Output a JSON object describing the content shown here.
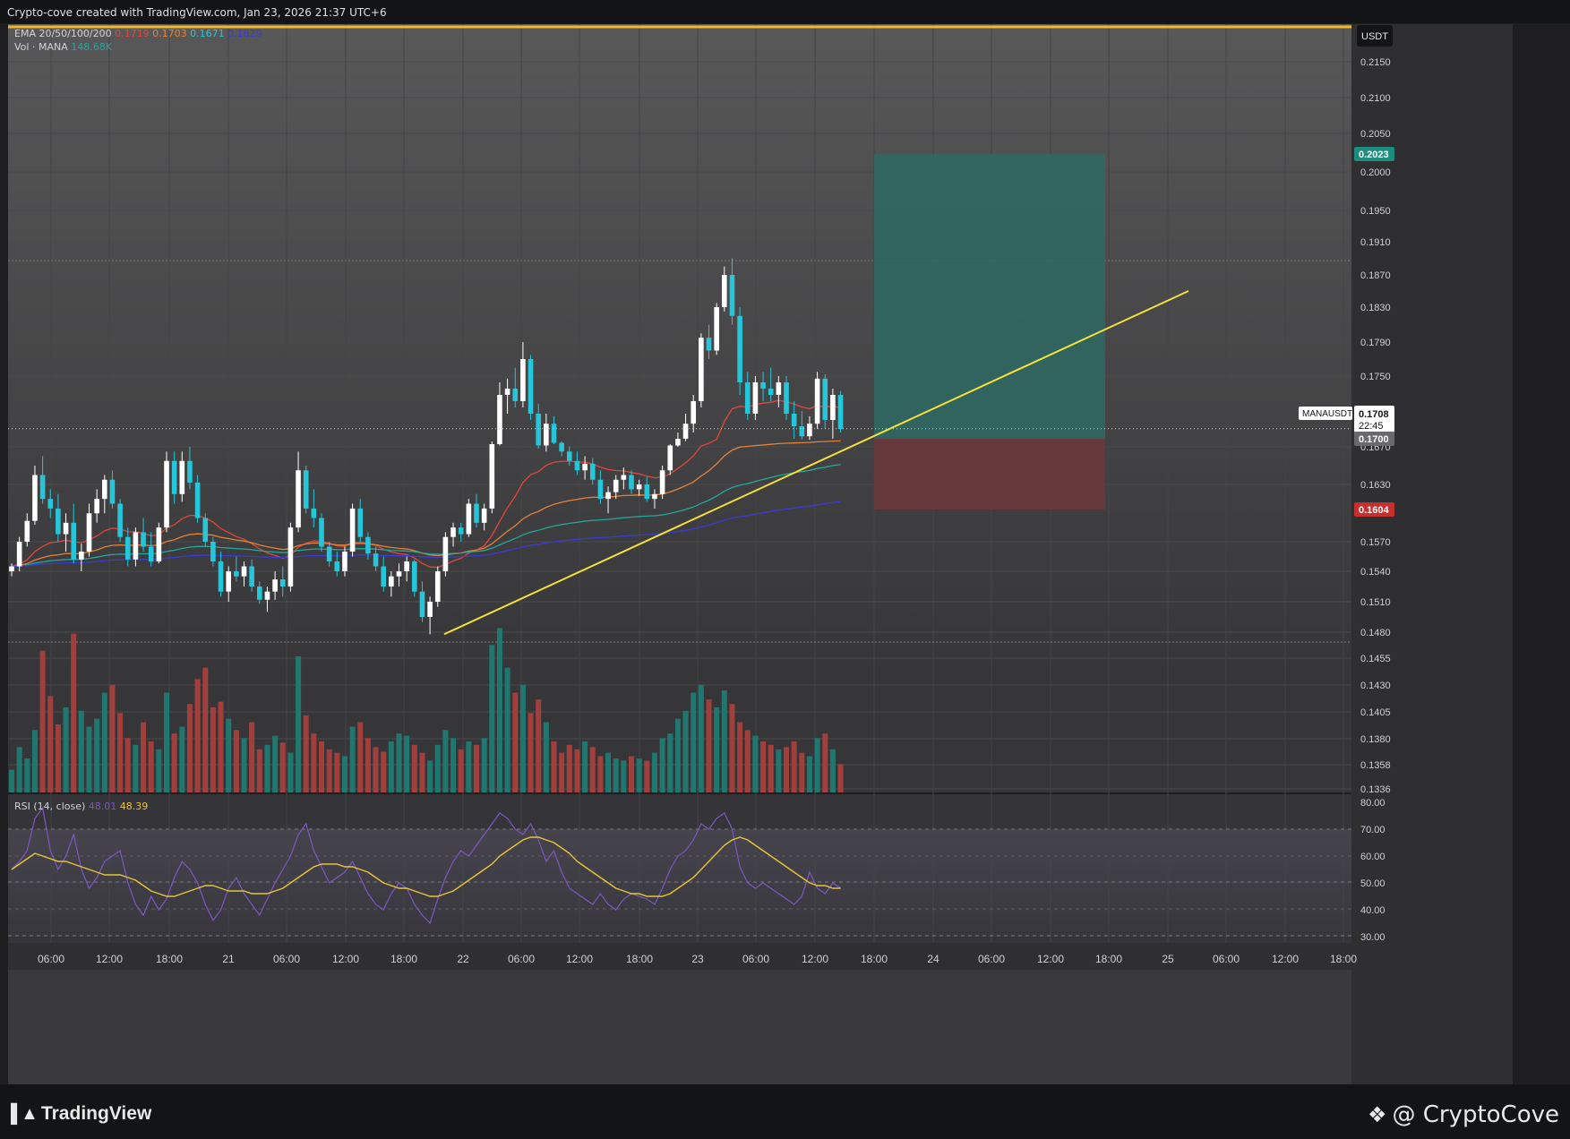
{
  "header": {
    "attribution": "Crypto-cove created with TradingView.com, Jan 23, 2026 21:37 UTC+6"
  },
  "legend": {
    "ema_label": "EMA 20/50/100/200",
    "ema_values": [
      "0.1719",
      "0.1703",
      "0.1671",
      "0.1629"
    ],
    "vol_label": "Vol · MANA",
    "vol_value": "148.68K",
    "rsi_label": "RSI (14, close)",
    "rsi_value": "48.01",
    "rsi_ma_value": "48.39"
  },
  "price_axis": {
    "currency": "USDT",
    "ticks": [
      "0.2150",
      "0.2100",
      "0.2050",
      "0.2000",
      "0.1950",
      "0.1910",
      "0.1870",
      "0.1830",
      "0.1790",
      "0.1750",
      "0.1670",
      "0.1630",
      "0.1570",
      "0.1540",
      "0.1510",
      "0.1480",
      "0.1455",
      "0.1430",
      "0.1405",
      "0.1380",
      "0.1358",
      "0.1336"
    ],
    "rsi_ticks": [
      "80.00",
      "70.00",
      "60.00",
      "50.00",
      "40.00",
      "30.00"
    ],
    "target_label": "0.2023",
    "current_symbol": "MANAUSDT",
    "current_price": "0.1708",
    "countdown": "22:45",
    "entry_label": "0.1700",
    "stop_label": "0.1604"
  },
  "time_axis": {
    "ticks": [
      "06:00",
      "12:00",
      "18:00",
      "21",
      "06:00",
      "12:00",
      "18:00",
      "22",
      "06:00",
      "12:00",
      "18:00",
      "23",
      "06:00",
      "12:00",
      "18:00",
      "24",
      "06:00",
      "12:00",
      "18:00",
      "25",
      "06:00",
      "12:00",
      "18:00"
    ]
  },
  "footer": {
    "tv_brand": "TradingView",
    "cc_brand": "@ CryptoCove"
  },
  "colors": {
    "up": "#26a69a",
    "down": "#ef5350",
    "trendline": "#f5e13a",
    "ema20": "#e0463b",
    "ema50": "#e3823b",
    "ema100": "#26a69a",
    "ema200": "#3b3bd6",
    "target_zone": "#2e6a63",
    "stop_zone": "#6a3a3c",
    "rsi": "#7e57c2",
    "rsi_ma": "#e8c53a"
  },
  "chart_data": {
    "type": "candlestick",
    "symbol": "MANAUSDT",
    "ylim": [
      0.1336,
      0.218
    ],
    "x_range": [
      "Jan 20 02:00",
      "Jan 25 22:00"
    ],
    "trendline": {
      "from": [
        "Jan 21 20:00",
        0.1478
      ],
      "to": [
        "Jan 24 22:00",
        0.185
      ]
    },
    "position": {
      "entry": 0.17,
      "target": 0.2023,
      "stop": 0.1604,
      "last": 0.1708
    },
    "candles": [
      [
        0.154,
        0.1548,
        0.1535,
        0.1545
      ],
      [
        0.1545,
        0.1575,
        0.154,
        0.157
      ],
      [
        0.157,
        0.16,
        0.1565,
        0.1592
      ],
      [
        0.1592,
        0.165,
        0.1588,
        0.164
      ],
      [
        0.164,
        0.166,
        0.161,
        0.1615
      ],
      [
        0.1615,
        0.1625,
        0.1595,
        0.1605
      ],
      [
        0.1605,
        0.162,
        0.157,
        0.1578
      ],
      [
        0.1578,
        0.16,
        0.156,
        0.159
      ],
      [
        0.159,
        0.161,
        0.1548,
        0.1552
      ],
      [
        0.1552,
        0.1568,
        0.154,
        0.156
      ],
      [
        0.156,
        0.161,
        0.1555,
        0.16
      ],
      [
        0.16,
        0.1625,
        0.159,
        0.1615
      ],
      [
        0.1615,
        0.164,
        0.16,
        0.1635
      ],
      [
        0.1635,
        0.1645,
        0.1605,
        0.161
      ],
      [
        0.161,
        0.1615,
        0.157,
        0.1575
      ],
      [
        0.1575,
        0.1585,
        0.1545,
        0.1552
      ],
      [
        0.1552,
        0.1585,
        0.1545,
        0.158
      ],
      [
        0.158,
        0.1595,
        0.156,
        0.1565
      ],
      [
        0.1565,
        0.158,
        0.1545,
        0.155
      ],
      [
        0.155,
        0.159,
        0.1548,
        0.1585
      ],
      [
        0.1585,
        0.1665,
        0.158,
        0.1655
      ],
      [
        0.1655,
        0.1665,
        0.161,
        0.162
      ],
      [
        0.162,
        0.1665,
        0.1612,
        0.1655
      ],
      [
        0.1655,
        0.167,
        0.1625,
        0.1632
      ],
      [
        0.1632,
        0.164,
        0.159,
        0.1595
      ],
      [
        0.1595,
        0.16,
        0.1565,
        0.157
      ],
      [
        0.157,
        0.1575,
        0.1545,
        0.155
      ],
      [
        0.155,
        0.156,
        0.1515,
        0.152
      ],
      [
        0.152,
        0.1545,
        0.151,
        0.154
      ],
      [
        0.154,
        0.1555,
        0.153,
        0.1535
      ],
      [
        0.1535,
        0.155,
        0.1525,
        0.1545
      ],
      [
        0.1545,
        0.1552,
        0.152,
        0.1525
      ],
      [
        0.1525,
        0.153,
        0.1508,
        0.1512
      ],
      [
        0.1512,
        0.1525,
        0.15,
        0.152
      ],
      [
        0.152,
        0.154,
        0.1512,
        0.1532
      ],
      [
        0.1532,
        0.1545,
        0.1515,
        0.1525
      ],
      [
        0.1525,
        0.159,
        0.152,
        0.1585
      ],
      [
        0.1585,
        0.1665,
        0.158,
        0.1645
      ],
      [
        0.1645,
        0.165,
        0.16,
        0.1605
      ],
      [
        0.1605,
        0.1625,
        0.1585,
        0.1595
      ],
      [
        0.1595,
        0.16,
        0.156,
        0.1565
      ],
      [
        0.1565,
        0.157,
        0.1545,
        0.155
      ],
      [
        0.155,
        0.156,
        0.1535,
        0.154
      ],
      [
        0.154,
        0.1565,
        0.1535,
        0.156
      ],
      [
        0.156,
        0.161,
        0.1555,
        0.1605
      ],
      [
        0.1605,
        0.1615,
        0.157,
        0.1575
      ],
      [
        0.1575,
        0.158,
        0.1552,
        0.1558
      ],
      [
        0.1558,
        0.1565,
        0.154,
        0.1545
      ],
      [
        0.1545,
        0.1555,
        0.152,
        0.1525
      ],
      [
        0.1525,
        0.154,
        0.1515,
        0.1535
      ],
      [
        0.1535,
        0.1548,
        0.1525,
        0.154
      ],
      [
        0.154,
        0.1555,
        0.153,
        0.155
      ],
      [
        0.155,
        0.1552,
        0.1515,
        0.152
      ],
      [
        0.152,
        0.153,
        0.149,
        0.1495
      ],
      [
        0.1495,
        0.1515,
        0.1478,
        0.151
      ],
      [
        0.151,
        0.1545,
        0.1505,
        0.154
      ],
      [
        0.154,
        0.158,
        0.1535,
        0.1575
      ],
      [
        0.1575,
        0.159,
        0.1565,
        0.1585
      ],
      [
        0.1585,
        0.159,
        0.157,
        0.1578
      ],
      [
        0.1578,
        0.1615,
        0.1575,
        0.161
      ],
      [
        0.161,
        0.162,
        0.1585,
        0.159
      ],
      [
        0.159,
        0.161,
        0.1582,
        0.1605
      ],
      [
        0.1605,
        0.169,
        0.16,
        0.168
      ],
      [
        0.168,
        0.1745,
        0.1675,
        0.1735
      ],
      [
        0.1735,
        0.1748,
        0.172,
        0.174
      ],
      [
        0.174,
        0.176,
        0.1725,
        0.173
      ],
      [
        0.173,
        0.179,
        0.1725,
        0.177
      ],
      [
        0.177,
        0.1775,
        0.1715,
        0.172
      ],
      [
        0.172,
        0.1728,
        0.1668,
        0.1675
      ],
      [
        0.1675,
        0.172,
        0.1665,
        0.1712
      ],
      [
        0.1712,
        0.1718,
        0.168,
        0.1685
      ],
      [
        0.1685,
        0.169,
        0.166,
        0.1665
      ],
      [
        0.1665,
        0.1672,
        0.165,
        0.1655
      ],
      [
        0.1655,
        0.1665,
        0.164,
        0.1645
      ],
      [
        0.1645,
        0.166,
        0.1635,
        0.1652
      ],
      [
        0.1652,
        0.1658,
        0.163,
        0.1635
      ],
      [
        0.1635,
        0.1645,
        0.161,
        0.1615
      ],
      [
        0.1615,
        0.1628,
        0.16,
        0.1622
      ],
      [
        0.1622,
        0.164,
        0.1615,
        0.1635
      ],
      [
        0.1635,
        0.1648,
        0.1625,
        0.164
      ],
      [
        0.164,
        0.1645,
        0.162,
        0.1625
      ],
      [
        0.1625,
        0.1635,
        0.1618,
        0.163
      ],
      [
        0.163,
        0.1638,
        0.1612,
        0.1615
      ],
      [
        0.1615,
        0.1625,
        0.1605,
        0.162
      ],
      [
        0.162,
        0.165,
        0.1615,
        0.1645
      ],
      [
        0.1645,
        0.168,
        0.164,
        0.1675
      ],
      [
        0.1675,
        0.1705,
        0.167,
        0.17
      ],
      [
        0.17,
        0.172,
        0.169,
        0.1712
      ],
      [
        0.1712,
        0.1735,
        0.1705,
        0.173
      ],
      [
        0.173,
        0.18,
        0.1725,
        0.1795
      ],
      [
        0.1795,
        0.181,
        0.177,
        0.178
      ],
      [
        0.178,
        0.1835,
        0.1775,
        0.183
      ],
      [
        0.183,
        0.188,
        0.1825,
        0.187
      ],
      [
        0.187,
        0.189,
        0.181,
        0.182
      ],
      [
        0.182,
        0.183,
        0.1735,
        0.1745
      ],
      [
        0.1745,
        0.1755,
        0.1715,
        0.172
      ],
      [
        0.172,
        0.175,
        0.1715,
        0.1745
      ],
      [
        0.1745,
        0.1755,
        0.173,
        0.174
      ],
      [
        0.174,
        0.176,
        0.173,
        0.1735
      ],
      [
        0.1735,
        0.175,
        0.1725,
        0.1745
      ],
      [
        0.1745,
        0.175,
        0.1715,
        0.172
      ],
      [
        0.172,
        0.173,
        0.17,
        0.171
      ],
      [
        0.171,
        0.1722,
        0.1698,
        0.1702
      ],
      [
        0.1702,
        0.1718,
        0.1696,
        0.1712
      ],
      [
        0.1712,
        0.1755,
        0.1708,
        0.1748
      ],
      [
        0.1748,
        0.1752,
        0.1708,
        0.1715
      ],
      [
        0.1715,
        0.174,
        0.17,
        0.1735
      ],
      [
        0.1735,
        0.1738,
        0.1705,
        0.1708
      ]
    ],
    "volumes": [
      20,
      40,
      30,
      55,
      125,
      85,
      60,
      75,
      140,
      72,
      58,
      65,
      88,
      95,
      70,
      48,
      42,
      62,
      45,
      38,
      88,
      52,
      58,
      78,
      100,
      110,
      75,
      80,
      65,
      55,
      48,
      62,
      38,
      42,
      50,
      44,
      35,
      120,
      68,
      52,
      45,
      38,
      35,
      32,
      58,
      62,
      48,
      40,
      36,
      45,
      52,
      50,
      42,
      35,
      28,
      42,
      55,
      48,
      38,
      45,
      42,
      48,
      130,
      145,
      110,
      88,
      95,
      70,
      82,
      62,
      45,
      35,
      42,
      38,
      45,
      40,
      32,
      35,
      30,
      28,
      32,
      30,
      28,
      35,
      48,
      52,
      65,
      72,
      88,
      95,
      82,
      75,
      90,
      78,
      62,
      55,
      50,
      45,
      42,
      38,
      40,
      45,
      35,
      32,
      48,
      52,
      38,
      25
    ],
    "rsi": [
      55,
      58,
      62,
      74,
      78,
      62,
      55,
      60,
      68,
      55,
      48,
      52,
      58,
      60,
      62,
      50,
      42,
      38,
      45,
      40,
      44,
      52,
      58,
      55,
      50,
      42,
      36,
      40,
      48,
      52,
      46,
      42,
      38,
      44,
      50,
      55,
      60,
      68,
      72,
      62,
      56,
      50,
      52,
      54,
      58,
      52,
      46,
      42,
      40,
      46,
      50,
      48,
      42,
      38,
      35,
      44,
      52,
      58,
      62,
      60,
      64,
      68,
      72,
      76,
      74,
      70,
      68,
      72,
      66,
      58,
      62,
      54,
      48,
      46,
      44,
      42,
      46,
      42,
      40,
      44,
      46,
      45,
      44,
      42,
      48,
      55,
      60,
      62,
      66,
      72,
      70,
      74,
      76,
      70,
      56,
      50,
      48,
      50,
      48,
      46,
      44,
      42,
      45,
      54,
      48,
      46,
      50,
      48
    ],
    "rsi_ma": [
      55,
      57,
      59,
      61,
      60,
      59,
      58,
      58,
      57,
      56,
      55,
      54,
      53,
      53,
      53,
      52,
      51,
      49,
      47,
      46,
      45,
      45,
      46,
      47,
      48,
      49,
      49,
      48,
      47,
      47,
      47,
      46,
      46,
      46,
      47,
      48,
      50,
      52,
      54,
      56,
      57,
      57,
      57,
      56,
      56,
      55,
      54,
      52,
      50,
      49,
      48,
      48,
      47,
      46,
      45,
      45,
      46,
      47,
      49,
      51,
      53,
      55,
      57,
      60,
      62,
      64,
      66,
      67,
      67,
      66,
      65,
      63,
      61,
      58,
      56,
      54,
      52,
      50,
      48,
      47,
      46,
      46,
      45,
      45,
      45,
      46,
      48,
      50,
      52,
      55,
      58,
      61,
      64,
      66,
      67,
      66,
      64,
      62,
      60,
      58,
      56,
      54,
      52,
      50,
      49,
      49,
      48,
      48
    ]
  }
}
